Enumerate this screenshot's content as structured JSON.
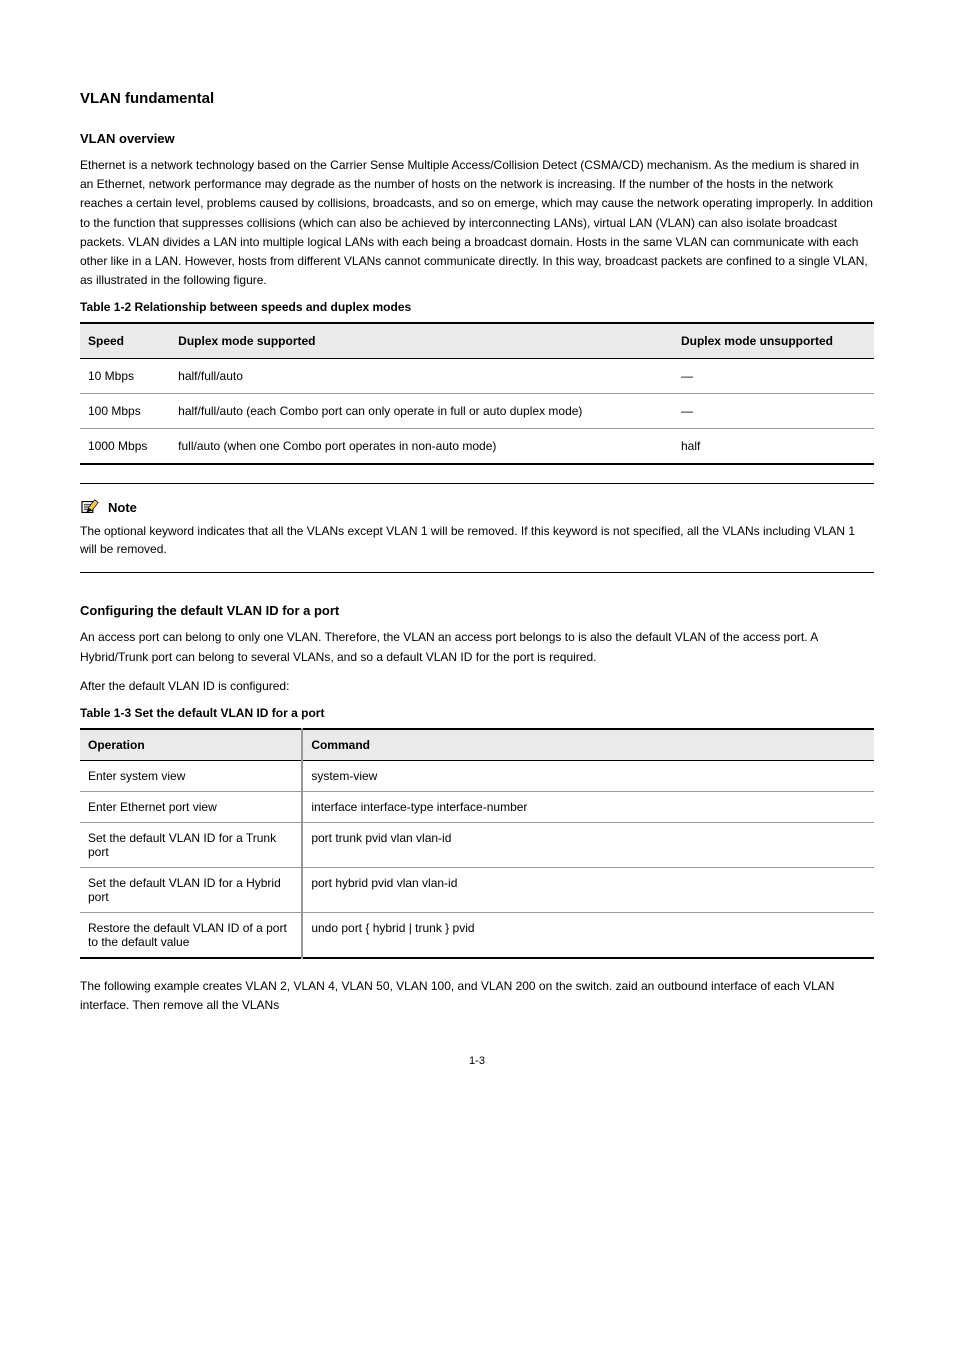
{
  "header": {
    "section_title": "VLAN fundamental",
    "section_subheading": "VLAN overview"
  },
  "intro_paragraph": "Ethernet is a network technology based on the Carrier Sense Multiple Access/Collision Detect (CSMA/CD) mechanism. As the medium is shared in an Ethernet, network performance may degrade as the number of hosts on the network is increasing. If the number of the hosts in the network reaches a certain level, problems caused by collisions, broadcasts, and so on emerge, which may cause the network operating improperly. In addition to the function that suppresses collisions (which can also be achieved by interconnecting LANs), virtual LAN (VLAN) can also isolate broadcast packets. VLAN divides a LAN into multiple logical LANs with each being a broadcast domain. Hosts in the same VLAN can communicate with each other like in a LAN. However, hosts from different VLANs cannot communicate directly. In this way, broadcast packets are confined to a single VLAN, as illustrated in the following figure.",
  "table1": {
    "caption": "Table 1-2 Relationship between speeds and duplex modes",
    "headers": [
      "Speed",
      "Duplex mode supported",
      "Duplex mode unsupported"
    ],
    "rows": [
      [
        "10 Mbps",
        "half/full/auto",
        "—"
      ],
      [
        "100 Mbps",
        "half/full/auto (each Combo port can only operate in full or auto duplex mode)",
        "—"
      ],
      [
        "1000 Mbps",
        "full/auto (when one Combo port operates in non-auto mode)",
        "half"
      ]
    ]
  },
  "note": {
    "label": "Note",
    "text": "The optional keyword indicates that all the VLANs except VLAN 1 will be removed. If this keyword is not specified, all the VLANs including VLAN 1 will be removed."
  },
  "config_section": {
    "title": "Configuring the default VLAN ID for a port",
    "para1": "An access port can belong to only one VLAN. Therefore, the VLAN an access port belongs to is also the default VLAN of the access port. A Hybrid/Trunk port can belong to several VLANs, and so a default VLAN ID for the port is required.",
    "para2": "After the default VLAN ID is configured:",
    "table_caption": "Table 1-3 Set the default VLAN ID for a port",
    "table_headers": [
      "Operation",
      "Command"
    ],
    "table_rows": [
      [
        "Enter system view",
        "system-view"
      ],
      [
        "Enter Ethernet port view",
        "interface interface-type interface-number"
      ],
      [
        "Set the default VLAN ID for a Trunk port",
        "port trunk pvid vlan vlan-id"
      ],
      [
        "Set the default VLAN ID for a Hybrid port",
        "port hybrid pvid vlan vlan-id"
      ],
      [
        "Restore the default VLAN ID of a port to the default value",
        "undo port { hybrid | trunk } pvid"
      ]
    ]
  },
  "closing_paragraph": "The following example creates VLAN 2, VLAN 4, VLAN 50, VLAN 100, and VLAN 200 on the switch. zaid an outbound interface of each VLAN interface. Then remove all the VLANs",
  "page_number": "1-3"
}
